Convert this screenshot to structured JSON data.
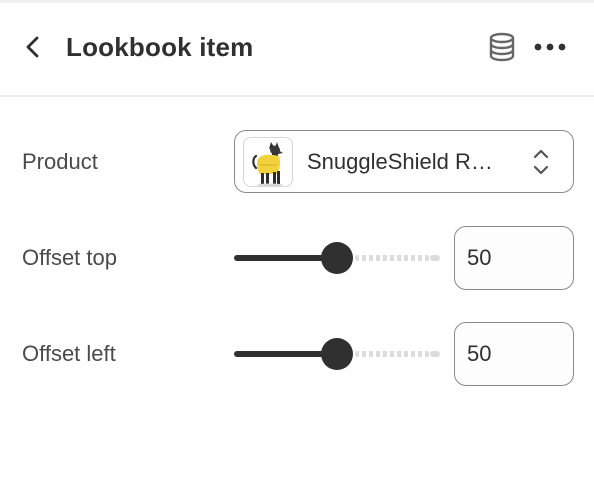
{
  "header": {
    "title": "Lookbook item",
    "back_icon": "chevron-left-icon",
    "data_source_icon": "database-icon",
    "more_icon": "ellipsis-horizontal-icon"
  },
  "fields": {
    "product": {
      "label": "Product",
      "value": "SnuggleShield R…",
      "thumbnail_icon": "dog-in-yellow-raincoat-image",
      "selector_icon": "chevron-up-down-icon"
    },
    "offset_top": {
      "label": "Offset top",
      "value": "50",
      "slider_percent": 50
    },
    "offset_left": {
      "label": "Offset left",
      "value": "50",
      "slider_percent": 50
    }
  },
  "colors": {
    "text": "#303030",
    "border": "#8a8a8a",
    "slider_fill": "#303030",
    "slider_track": "#dcdcdc",
    "coat_yellow": "#f2d23c"
  }
}
